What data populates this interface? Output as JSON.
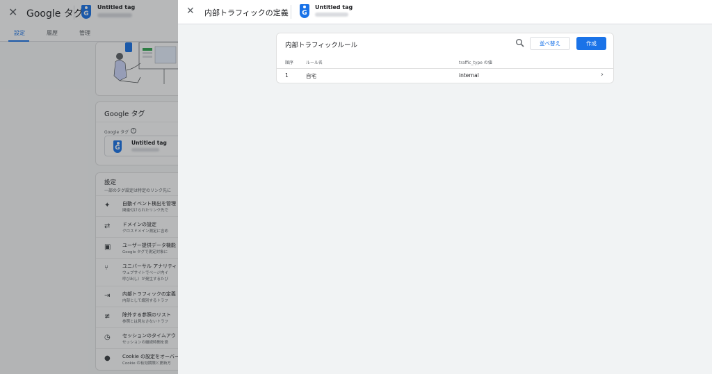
{
  "background": {
    "app_title": "Google タグ",
    "tag_name": "Untitled tag",
    "tabs": [
      {
        "label": "設定",
        "active": true
      },
      {
        "label": "履歴",
        "active": false
      },
      {
        "label": "管理",
        "active": false
      }
    ],
    "google_tag_card": {
      "title": "Google タグ",
      "label": "Google タグ",
      "tag_name": "Untitled tag"
    },
    "settings_card": {
      "title": "設定",
      "subtitle": "一部のタグ設定は特定のリンク先に",
      "items": [
        {
          "icon": "sparkle-icon",
          "title": "自動イベント検出を管理",
          "subtitle": "関連付けられたリンク先で"
        },
        {
          "icon": "cross-domain-icon",
          "title": "ドメインの設定",
          "subtitle": "クロスドメイン測定に含め"
        },
        {
          "icon": "user-data-icon",
          "title": "ユーザー提供データ機能",
          "subtitle": "Google タグで測定対象に"
        },
        {
          "icon": "fork-icon",
          "title": "ユニバーサル アナリティ",
          "subtitle": "ウェブサイトでページ内イ",
          "subtitle2": "呼び出し）が発生するたび"
        },
        {
          "icon": "internal-traffic-icon",
          "title": "内部トラフィックの定義",
          "subtitle": "内部として識別するトラフ"
        },
        {
          "icon": "referral-exclude-icon",
          "title": "除外する参照のリスト",
          "subtitle": "参照とは見なさないトラフ"
        },
        {
          "icon": "clock-icon",
          "title": "セッションのタイムアウ",
          "subtitle": "セッションの継続時間を設"
        },
        {
          "icon": "cookie-icon",
          "title": "Cookie の設定をオーバー",
          "subtitle": "Cookie の有効期限と更新方"
        }
      ]
    }
  },
  "panel": {
    "title": "内部トラフィックの定義",
    "tag_name": "Untitled tag",
    "rules_card": {
      "title": "内部トラフィックルール",
      "sort_label": "並べ替え",
      "create_label": "作成",
      "columns": [
        "順序",
        "ルール名",
        "traffic_type の値"
      ],
      "rows": [
        {
          "order": "1",
          "name": "自宅",
          "value": "internal"
        }
      ]
    }
  },
  "colors": {
    "accent": "#1a73e8",
    "overlay": "rgba(32,33,36,0.32)"
  }
}
